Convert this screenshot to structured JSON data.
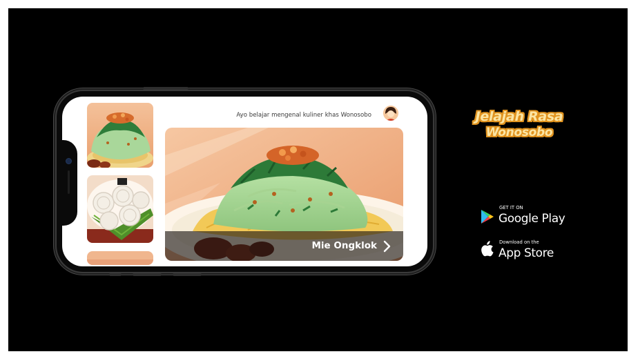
{
  "app": {
    "header_text": "Ayo belajar mengenal kuliner khas Wonosobo",
    "hero": {
      "title": "Mie Ongklok"
    },
    "thumbnails": [
      {
        "icon": "mie-ongklok-thumbnail"
      },
      {
        "icon": "rolled-cake-thumbnail"
      },
      {
        "icon": "partial-dish-thumbnail"
      }
    ]
  },
  "brand": {
    "line1": "Jelajah Rasa",
    "line2": "Wonosobo"
  },
  "stores": {
    "google_play": {
      "small": "GET IT ON",
      "big": "Google Play"
    },
    "app_store": {
      "small": "Download on the",
      "big": "App Store"
    }
  },
  "colors": {
    "background": "#000000",
    "logo_fill": "#fbe5a4",
    "logo_outline": "#e1931f",
    "hero_bar": "#19141299"
  }
}
